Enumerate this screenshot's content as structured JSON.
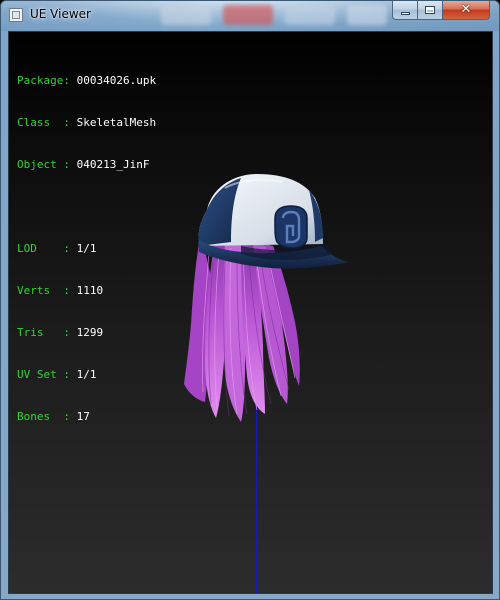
{
  "window": {
    "title": "UE Viewer",
    "close_glyph": "✕"
  },
  "icons": {
    "app": "ue-viewer-app-icon",
    "minimize": "minimize-icon",
    "maximize": "maximize-icon",
    "close": "close-icon"
  },
  "info": {
    "rows_top": [
      {
        "label": "Package:",
        "value": "00034026.upk"
      },
      {
        "label": "Class  :",
        "value": "SkeletalMesh"
      },
      {
        "label": "Object :",
        "value": "040213_JinF"
      }
    ],
    "rows_bottom": [
      {
        "label": "LOD    :",
        "value": "1/1"
      },
      {
        "label": "Verts  :",
        "value": "1110"
      },
      {
        "label": "Tris   :",
        "value": "1299"
      },
      {
        "label": "UV Set :",
        "value": "1/1"
      },
      {
        "label": "Bones  :",
        "value": "17"
      }
    ]
  },
  "colors": {
    "label_green": "#34d234",
    "value_white": "#ffffff",
    "hair_pink": "#d070e0",
    "cap_navy": "#1f3a66",
    "cap_white": "#e8eef4",
    "axis_blue": "#1a1ab0",
    "close_red": "#c2391c"
  }
}
